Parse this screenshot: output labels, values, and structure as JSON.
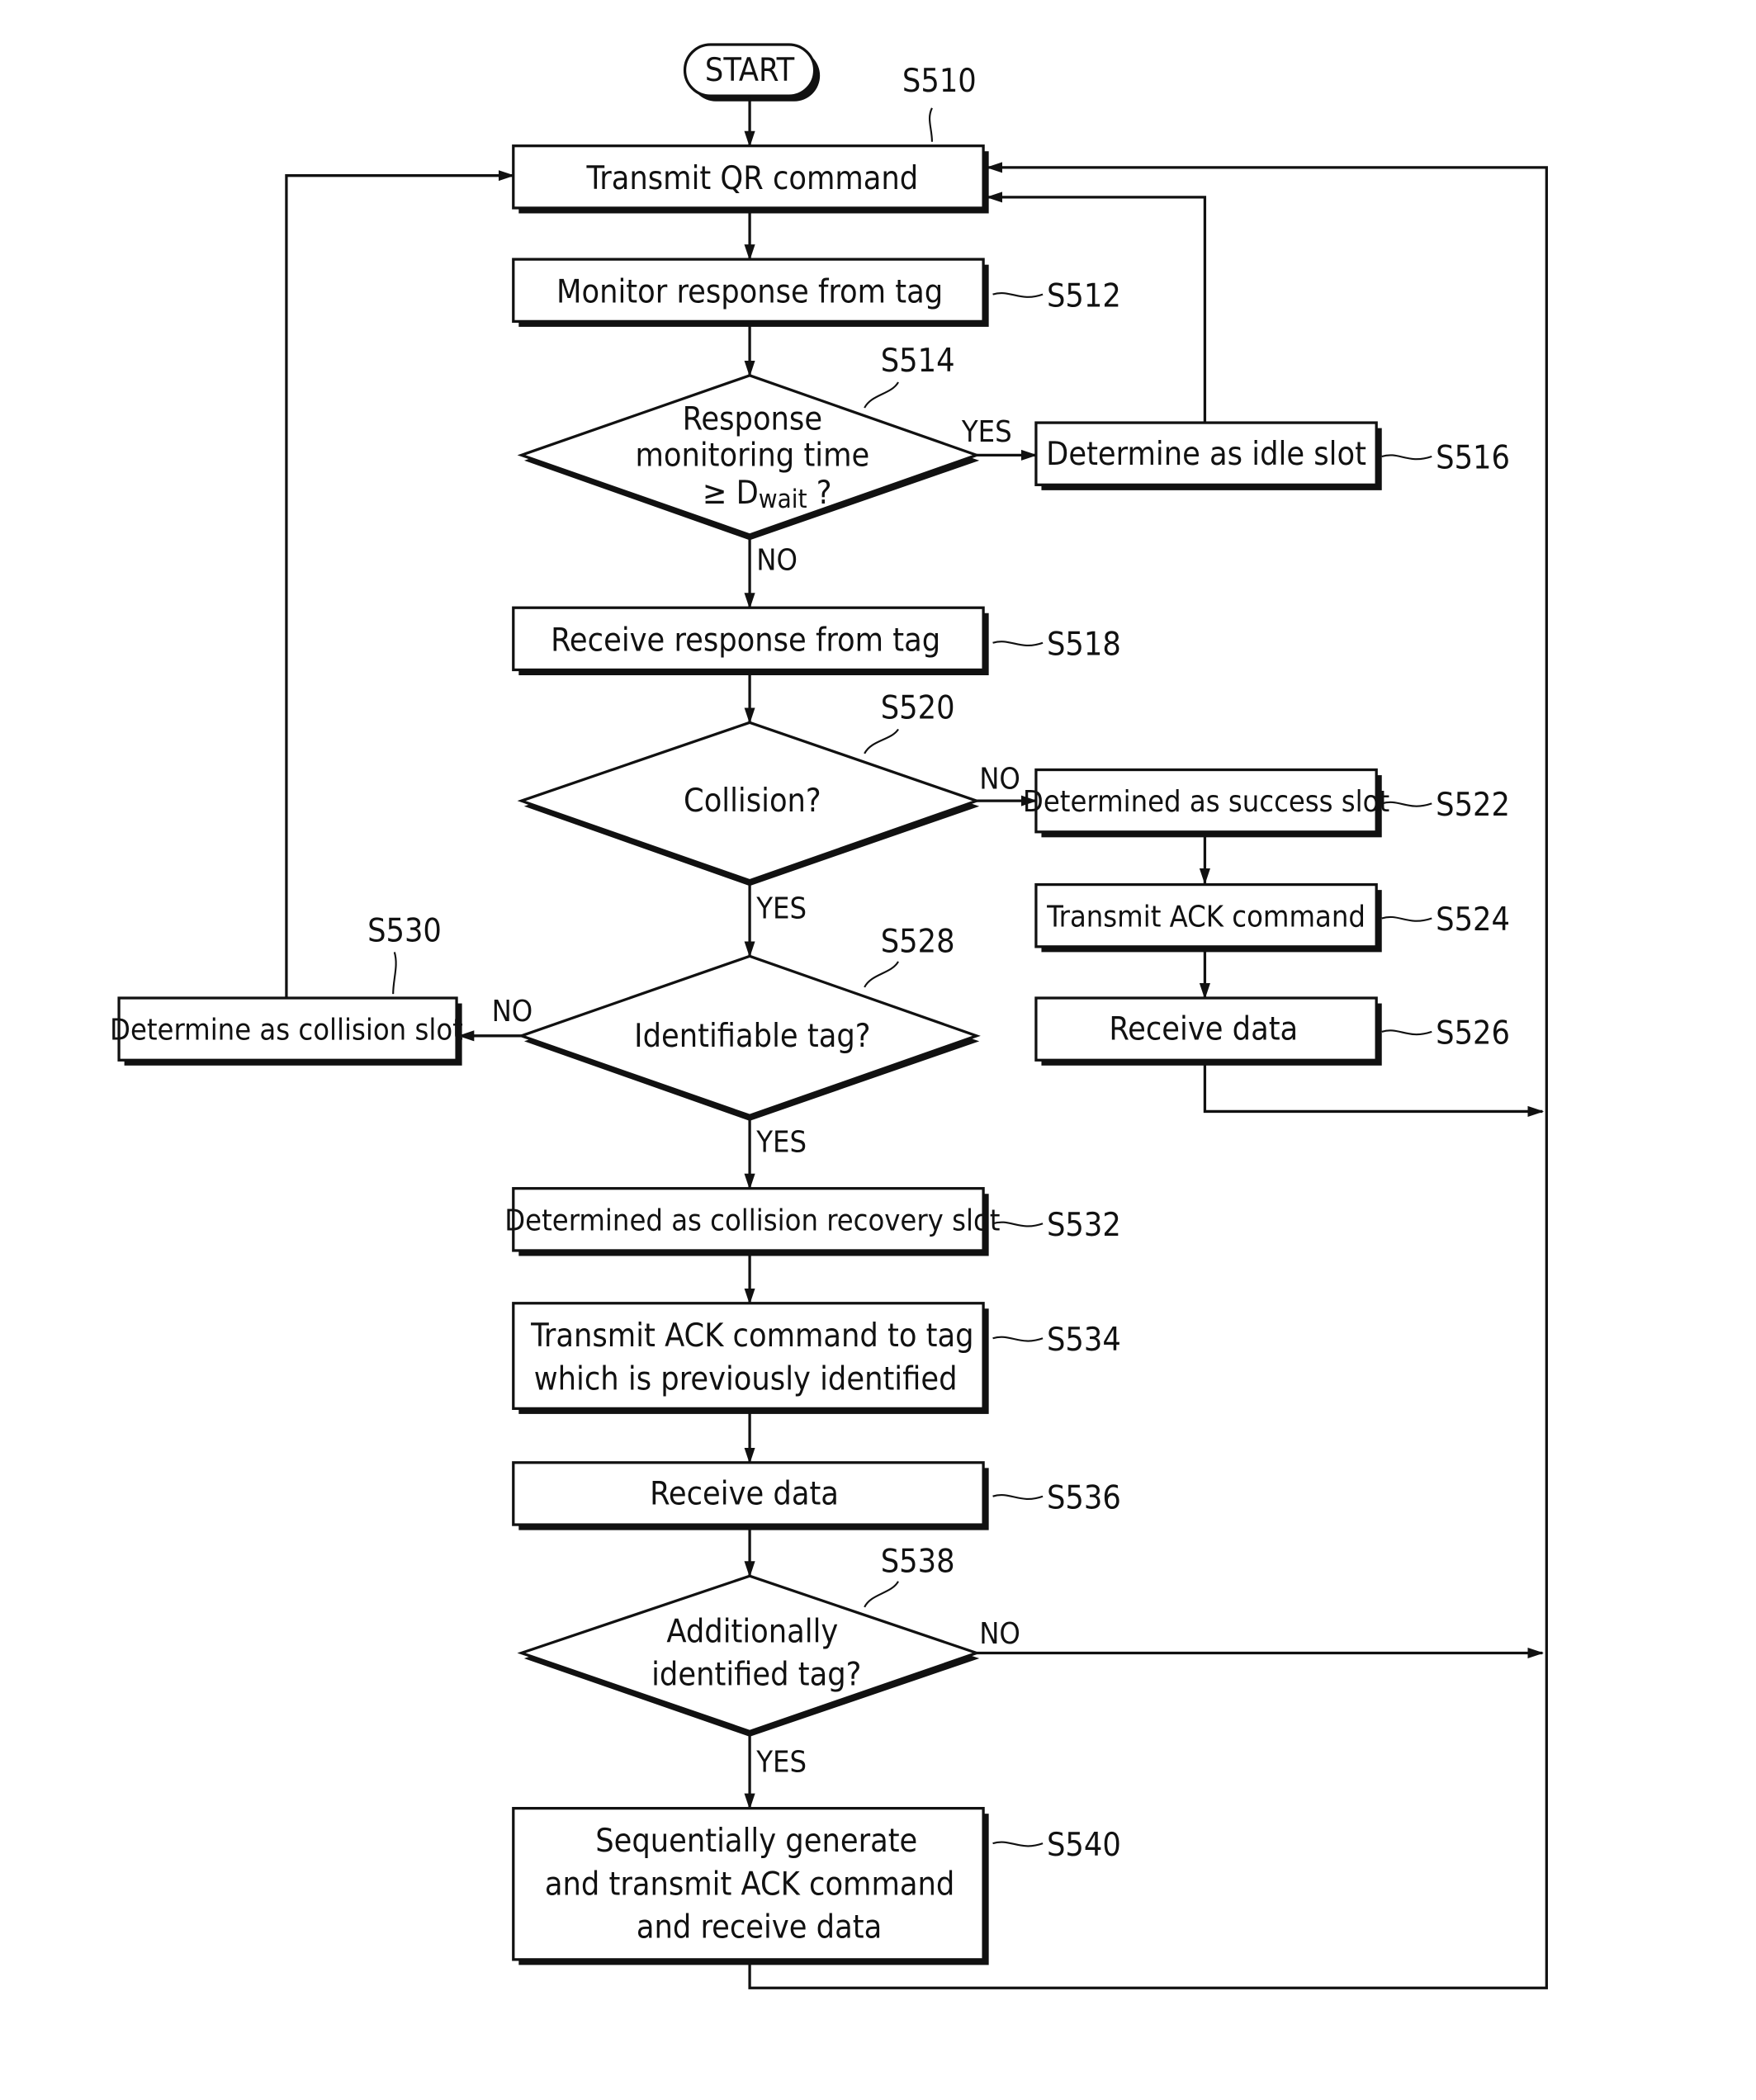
{
  "start": "START",
  "nodes": {
    "s510": {
      "id": "S510",
      "text": [
        "Transmit QR command"
      ]
    },
    "s512": {
      "id": "S512",
      "text": [
        "Monitor response from tag"
      ]
    },
    "s514": {
      "id": "S514",
      "text": [
        "Response",
        "monitoring time",
        "≥ D",
        "wait",
        " ?"
      ]
    },
    "s516": {
      "id": "S516",
      "text": [
        "Determine as idle slot"
      ]
    },
    "s518": {
      "id": "S518",
      "text": [
        "Receive response from tag"
      ]
    },
    "s520": {
      "id": "S520",
      "text": [
        "Collision?"
      ]
    },
    "s522": {
      "id": "S522",
      "text": [
        "Determined as success slot"
      ]
    },
    "s524": {
      "id": "S524",
      "text": [
        "Transmit ACK command"
      ]
    },
    "s526": {
      "id": "S526",
      "text": [
        "Receive data"
      ]
    },
    "s528": {
      "id": "S528",
      "text": [
        "Identifiable tag?"
      ]
    },
    "s530": {
      "id": "S530",
      "text": [
        "Determine as collision slot"
      ]
    },
    "s532": {
      "id": "S532",
      "text": [
        "Determined as collision recovery slot"
      ]
    },
    "s534": {
      "id": "S534",
      "text": [
        "Transmit ACK command to tag",
        "which is previously identified"
      ]
    },
    "s536": {
      "id": "S536",
      "text": [
        "Receive data"
      ]
    },
    "s538": {
      "id": "S538",
      "text": [
        "Additionally",
        "identified tag?"
      ]
    },
    "s540": {
      "id": "S540",
      "text": [
        "Sequentially generate",
        "and transmit ACK command",
        "and receive data"
      ]
    }
  },
  "edges": {
    "yes": "YES",
    "no": "NO"
  }
}
